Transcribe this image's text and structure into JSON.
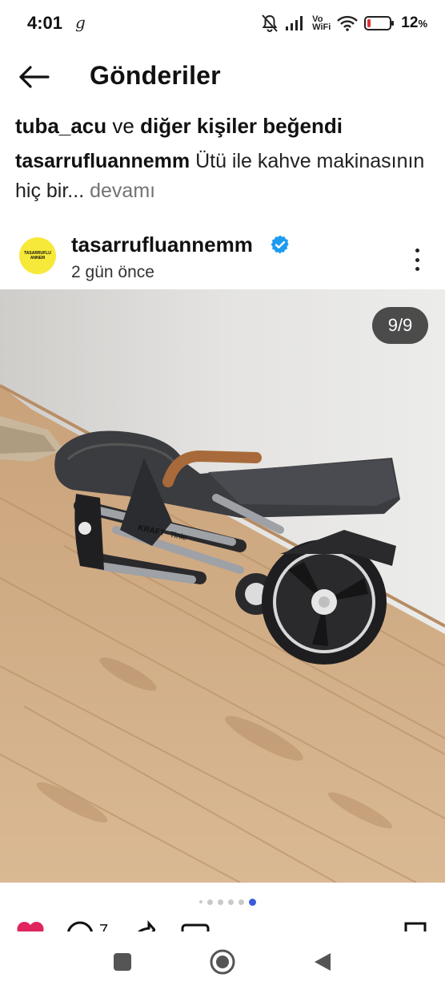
{
  "status_bar": {
    "time": "4:01",
    "extra_glyph": "g",
    "network_label_top": "Vo",
    "network_label_bottom": "WiFi",
    "battery_percent": "12",
    "battery_percent_sign": "%",
    "icons": [
      "mute-icon",
      "signal-icon",
      "wifi-icon",
      "battery-low-icon"
    ],
    "battery_level": 0.12
  },
  "header": {
    "title": "Gönderiler",
    "back_icon": "arrow-left-icon"
  },
  "likes": {
    "user": "tuba_acu",
    "connector": "ve",
    "others": "diğer kişiler beğendi"
  },
  "caption": {
    "username": "tasarrufluannemm",
    "text": "Ütü ile kahve makinasının hiç bir...",
    "more": "devamı"
  },
  "post": {
    "username": "tasarrufluannemm",
    "verified": true,
    "time": "2 gün önce",
    "avatar_text_line1": "TASARRUFLU",
    "avatar_text_line2": "ANNEM",
    "avatar_color": "#f7e93a",
    "stroller_brand": "KRAFT",
    "stroller_model": "Tinie"
  },
  "media": {
    "counter": "9/9",
    "total_images": 9,
    "current_image": 9
  },
  "actions": {
    "comment_count": "7",
    "like_color": "#e0245e"
  },
  "nav": {
    "buttons": [
      "recents-square-icon",
      "home-circle-icon",
      "back-triangle-icon"
    ]
  },
  "colors": {
    "accent": "#3b5bdb",
    "verified": "#1d9bf0",
    "muted_text": "#737373"
  }
}
